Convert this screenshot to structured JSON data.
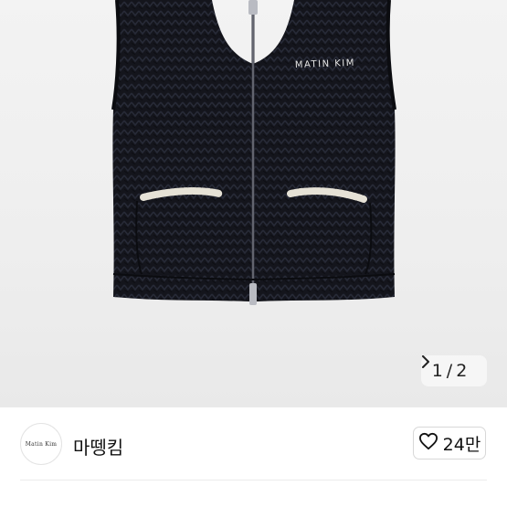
{
  "product": {
    "image_alt": "Matin Kim black knit zip-up vest",
    "embroidery_text": "MATIN KIM",
    "counter": {
      "current": "1",
      "separator": "/",
      "total": "2"
    },
    "next_icon": "chevron-right-icon"
  },
  "store": {
    "logo_text": "Matin Kim",
    "name": "마뗑킴",
    "like_icon": "heart-outline-icon",
    "like_count": "24만"
  },
  "colors": {
    "background": "#ffffff",
    "image_background": "#eeeeee",
    "vest": "#14151c",
    "pocket_trim": "#e6e2d6",
    "text_primary": "#111111",
    "border": "#d8d8d8"
  }
}
